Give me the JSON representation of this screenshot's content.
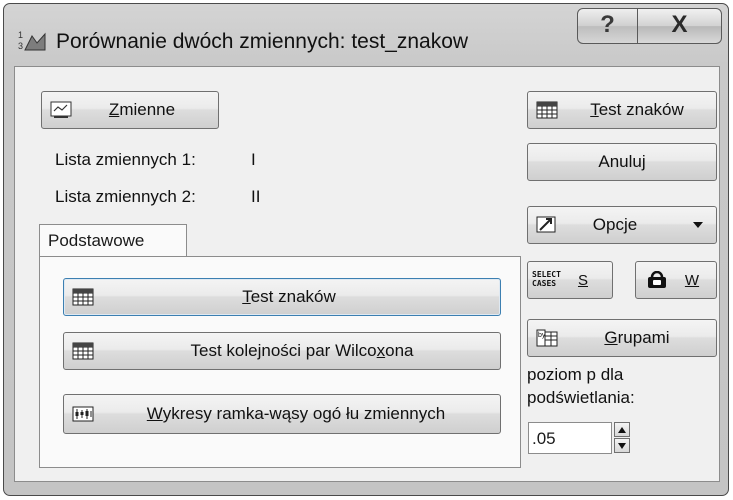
{
  "window": {
    "title": "Porównanie dwóch zmiennych: test_znakow",
    "help_glyph": "?",
    "close_glyph": "X"
  },
  "variables": {
    "button_label_u": "Z",
    "button_label_rest": "mienne",
    "list1_label": "Lista zmiennych 1:",
    "list1_value": "I",
    "list2_label": "Lista zmiennych 2:",
    "list2_value": "II"
  },
  "tabs": [
    {
      "label": "Podstawowe",
      "active": true
    }
  ],
  "basic": {
    "sign_test_u": "T",
    "sign_test_rest": "est znaków",
    "wilcoxon_pre": "Test kolejności par Wilco",
    "wilcoxon_u": "x",
    "wilcoxon_post": "ona",
    "boxplot_u": "W",
    "boxplot_rest": "ykresy ramka-wąsy ogó łu zmiennych"
  },
  "right": {
    "sign_test_u": "T",
    "sign_test_rest": "est znaków",
    "cancel": "Anuluj",
    "options": "Opcje",
    "select_cases_line1": "SELECT",
    "select_cases_line2": "CASES",
    "select_cases_key": "S",
    "weight_key": "W",
    "groups_u": "G",
    "groups_rest": "rupami",
    "p_level_label_1": "poziom p dla",
    "p_level_label_2": "podświetlania:",
    "p_level_value": ".05"
  },
  "icons": {
    "app": "chart-app-icon",
    "variables": "variables-icon",
    "table": "spreadsheet-icon",
    "boxplot": "boxplot-icon",
    "options": "options-wand-icon",
    "weight": "weight-icon",
    "groups": "groups-icon"
  }
}
